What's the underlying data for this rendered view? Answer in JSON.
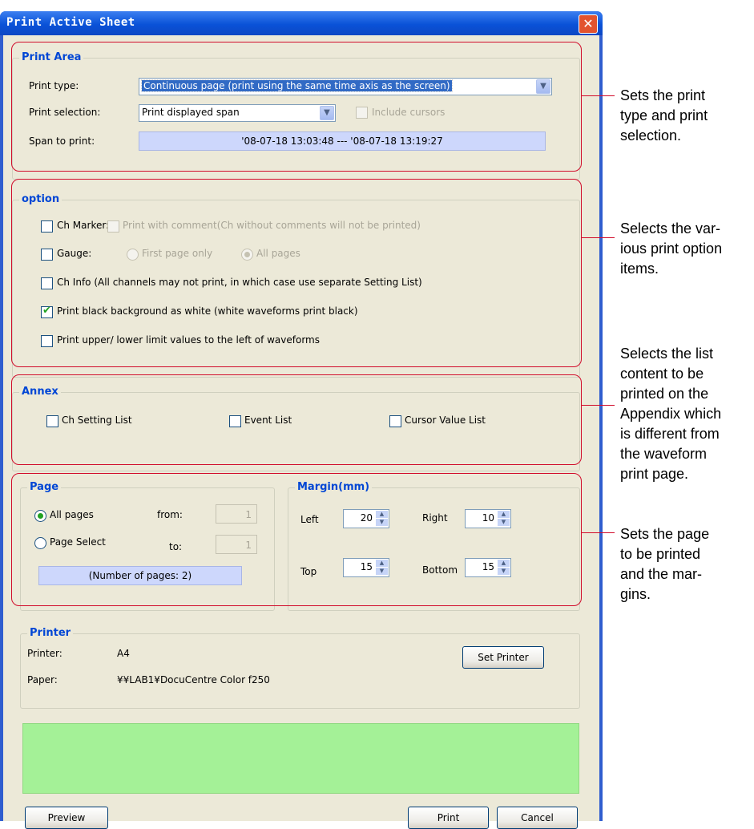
{
  "window": {
    "title": "Print Active Sheet",
    "close_glyph": "✕"
  },
  "print_area": {
    "legend": "Print Area",
    "print_type_label": "Print type:",
    "print_type_value": "Continuous page (print using the same time axis as the screen)",
    "print_selection_label": "Print selection:",
    "print_selection_value": "Print displayed span",
    "include_cursors_label": "Include cursors",
    "include_cursors_checked": false,
    "span_label": "Span to print:",
    "span_value": "'08-07-18 13:03:48 --- '08-07-18 13:19:27"
  },
  "option": {
    "legend": "option",
    "ch_marker_label": "Ch Marker:",
    "print_with_comment_label": "Print with comment(Ch without comments will not be printed)",
    "gauge_label": "Gauge:",
    "first_page_only_label": "First page only",
    "all_pages_label": "All pages",
    "ch_info_label": "Ch Info (All channels may not print, in which case use separate Setting List)",
    "print_black_bg_label": "Print black background as white (white waveforms print black)",
    "print_black_bg_checked": true,
    "print_limits_label": "Print upper/ lower limit values to the left of waveforms"
  },
  "annex": {
    "legend": "Annex",
    "ch_setting_list": "Ch Setting List",
    "event_list": "Event List",
    "cursor_value_list": "Cursor Value List"
  },
  "page": {
    "legend": "Page",
    "all_pages": "All pages",
    "page_select": "Page Select",
    "from_label": "from:",
    "from_value": "1",
    "to_label": "to:",
    "to_value": "1",
    "number_of_pages": "(Number of pages: 2)",
    "selected": "All pages"
  },
  "margin": {
    "legend": "Margin(mm)",
    "left_label": "Left",
    "left_value": "20",
    "right_label": "Right",
    "right_value": "10",
    "top_label": "Top",
    "top_value": "15",
    "bottom_label": "Bottom",
    "bottom_value": "15"
  },
  "printer": {
    "legend": "Printer",
    "printer_label": "Printer:",
    "printer_value": "A4",
    "paper_label": "Paper:",
    "paper_value": "¥¥LAB1¥DocuCentre Color f250",
    "set_printer_button": "Set Printer"
  },
  "buttons": {
    "preview": "Preview",
    "print": "Print",
    "cancel": "Cancel"
  },
  "annotations": {
    "print_type": [
      "Sets the print",
      "type and print",
      "selection."
    ],
    "options": [
      "Selects the var-",
      "ious print option",
      "items."
    ],
    "annex": [
      "Selects the list",
      "content to be",
      "printed on the",
      "Appendix which",
      "is different from",
      "the waveform",
      "print page."
    ],
    "page": [
      "Sets the page",
      "to be printed",
      "and the mar-",
      "gins."
    ]
  },
  "colors": {
    "callout": "#d10c2b",
    "status_area": "#a4f197",
    "legend_text": "#0046d5",
    "title_bar": "#0a52d8"
  }
}
